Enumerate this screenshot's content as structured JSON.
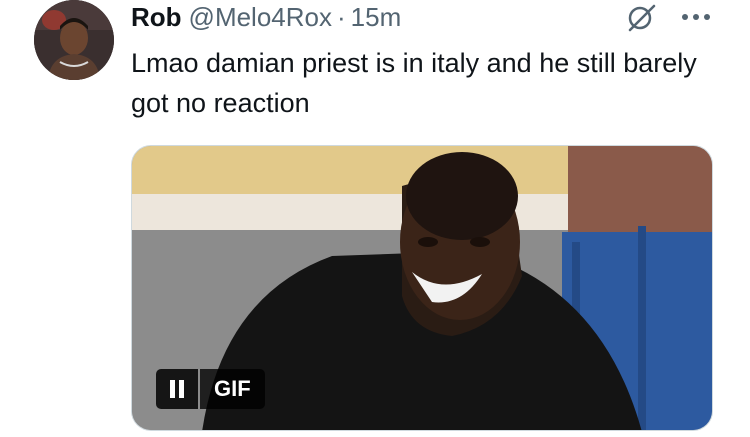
{
  "tweet": {
    "author_name": "Rob",
    "author_handle": "@Melo4Rox",
    "separator": "·",
    "timestamp": "15m",
    "text": "Lmao damian priest is in italy and he still barely got no reaction",
    "more_icon": "more-dots-icon",
    "grok_icon": "grok-slash-circle-icon"
  },
  "media": {
    "type": "gif",
    "badge_label": "GIF",
    "pause_icon": "pause-icon",
    "playing": true
  }
}
